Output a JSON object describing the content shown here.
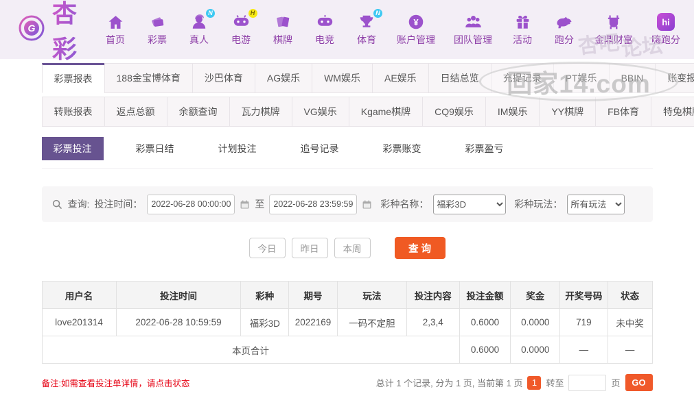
{
  "brand": {
    "name": "杏彩"
  },
  "colors": {
    "accent_purple": "#675390",
    "accent_orange": "#f05a23",
    "nav_purple": "#8e3fa8"
  },
  "nav": {
    "items": [
      {
        "label": "首页"
      },
      {
        "label": "彩票"
      },
      {
        "label": "真人",
        "badge": "N"
      },
      {
        "label": "电游",
        "badge": "H"
      },
      {
        "label": "棋牌"
      },
      {
        "label": "电竞"
      },
      {
        "label": "体育",
        "badge": "N"
      },
      {
        "label": "账户管理"
      },
      {
        "label": "团队管理"
      },
      {
        "label": "活动"
      },
      {
        "label": "跑分"
      },
      {
        "label": "金鼎财富"
      },
      {
        "label": "嗨跑分"
      }
    ]
  },
  "watermarks": {
    "corner": "回家14.com",
    "header_a": "杏吧",
    "header_b": "论坛"
  },
  "tabs": {
    "row1": [
      "彩票报表",
      "188金宝博体育",
      "沙巴体育",
      "AG娱乐",
      "WM娱乐",
      "AE娱乐",
      "日结总览",
      "充提记录",
      "PT娱乐",
      "BBIN",
      "账变报表"
    ],
    "row2": [
      "转账报表",
      "返点总额",
      "余额查询",
      "瓦力棋牌",
      "VG娱乐",
      "Kgame棋牌",
      "CQ9娱乐",
      "IM娱乐",
      "YY棋牌",
      "FB体育",
      "特兔棋牌"
    ]
  },
  "subtabs": [
    "彩票投注",
    "彩票日结",
    "计划投注",
    "追号记录",
    "彩票账变",
    "彩票盈亏"
  ],
  "search": {
    "query_label": "查询:",
    "time_label": "投注时间：",
    "from": "2022-06-28 00:00:00",
    "to_label": "至",
    "to": "2022-06-28 23:59:59",
    "lottery_label": "彩种名称：",
    "lottery_value": "福彩3D",
    "play_label": "彩种玩法：",
    "play_value": "所有玩法"
  },
  "quick": {
    "today": "今日",
    "yesterday": "昨日",
    "week": "本周",
    "search": "查 询"
  },
  "table": {
    "columns": [
      "用户名",
      "投注时间",
      "彩种",
      "期号",
      "玩法",
      "投注内容",
      "投注金额",
      "奖金",
      "开奖号码",
      "状态"
    ],
    "rows": [
      [
        "love201314",
        "2022-06-28 10:59:59",
        "福彩3D",
        "2022169",
        "一码不定胆",
        "2,3,4",
        "0.6000",
        "0.0000",
        "719",
        "未中奖"
      ]
    ],
    "summary": {
      "label": "本页合计",
      "bet_total": "0.6000",
      "prize_total": "0.0000",
      "open_dash": "—",
      "status_dash": "—"
    }
  },
  "footer": {
    "note": "备注:如需查看投注单详情，请点击状态",
    "pagination": {
      "summary": "总计 1 个记录, 分为 1 页, 当前第 1 页",
      "current": "1",
      "goto_label": "转至",
      "page_label": "页",
      "go": "GO"
    }
  }
}
